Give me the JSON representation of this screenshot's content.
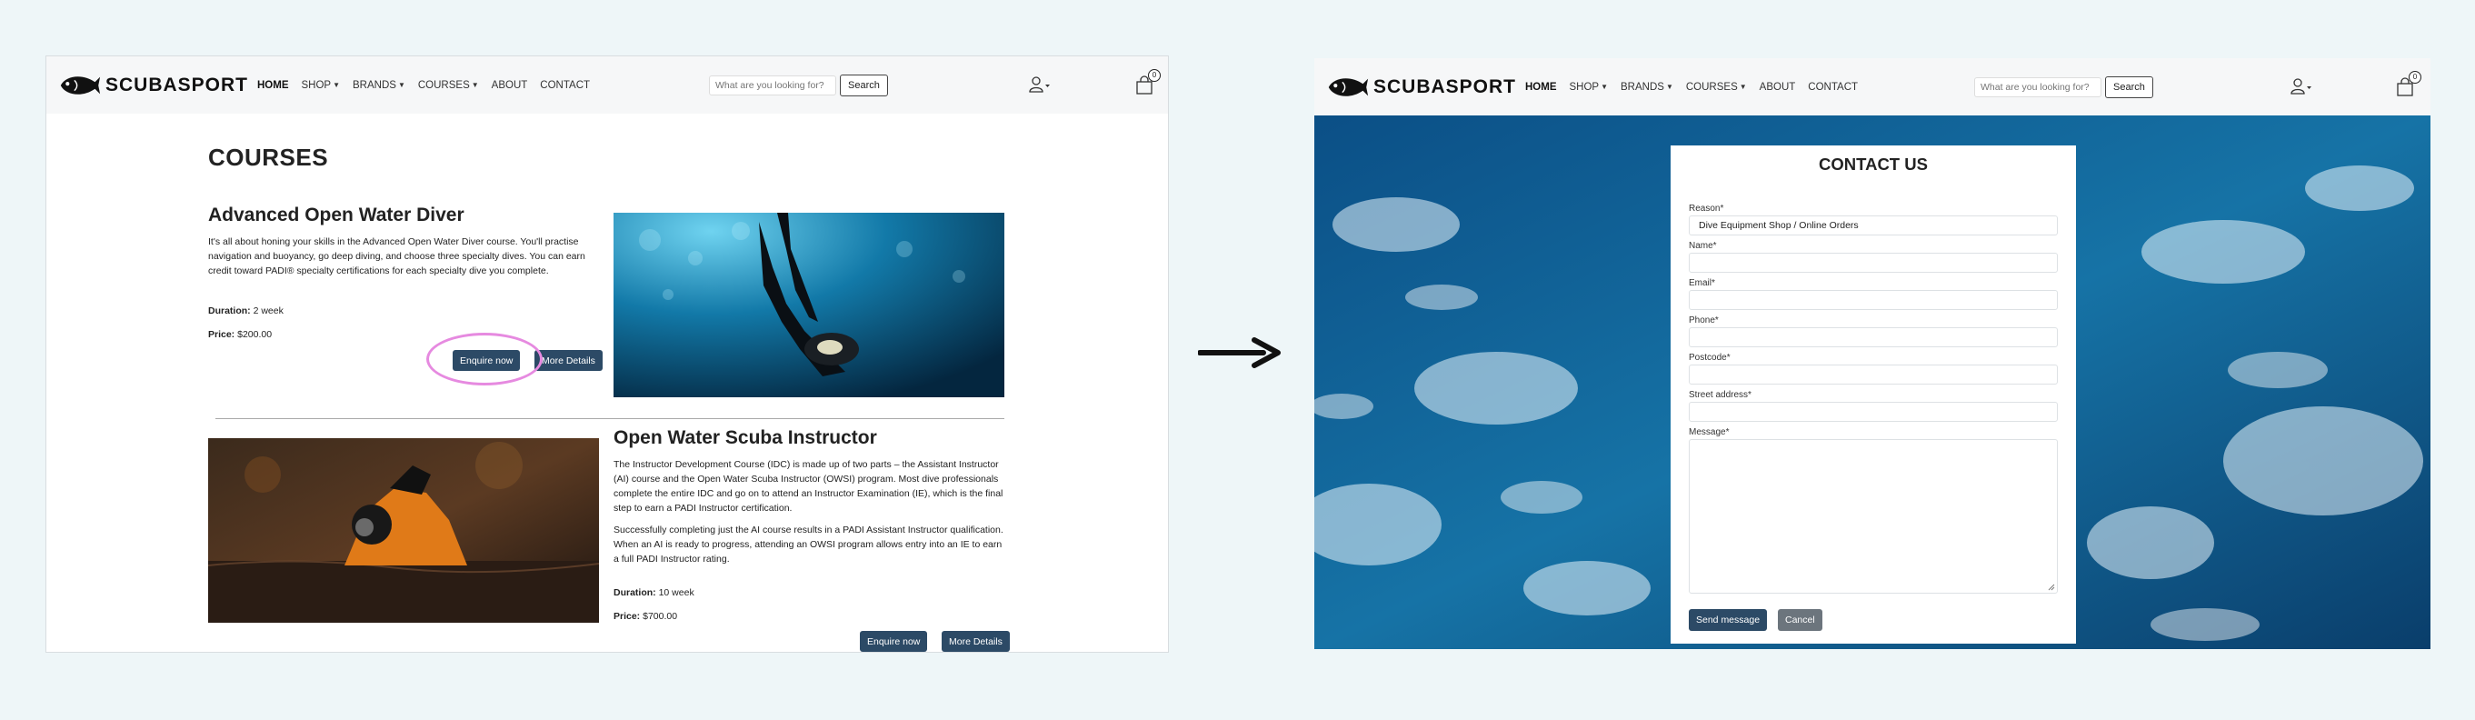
{
  "brand": {
    "name": "SCUBASPORT"
  },
  "nav": {
    "items": [
      {
        "label": "HOME",
        "active": true,
        "dropdown": false
      },
      {
        "label": "SHOP",
        "active": false,
        "dropdown": true
      },
      {
        "label": "BRANDS",
        "active": false,
        "dropdown": true
      },
      {
        "label": "COURSES",
        "active": false,
        "dropdown": true
      },
      {
        "label": "ABOUT",
        "active": false,
        "dropdown": false
      },
      {
        "label": "CONTACT",
        "active": false,
        "dropdown": false
      }
    ],
    "search_placeholder": "What are you looking for?",
    "search_button": "Search",
    "cart_count": "0",
    "icons": {
      "user": "user-icon",
      "cart": "shopping-bag-icon"
    }
  },
  "courses_page": {
    "heading": "COURSES",
    "course1": {
      "title": "Advanced Open Water Diver",
      "description": "It's all about honing your skills in the Advanced Open Water Diver course. You'll practise navigation and buoyancy, go deep diving, and choose three specialty dives. You can earn credit toward PADI® specialty certifications for each specialty dive you complete.",
      "duration_label": "Duration:",
      "duration_value": " 2 week",
      "price_label": "Price:",
      "price_value": " $200.00",
      "enquire_label": "Enquire now",
      "details_label": "More Details"
    },
    "course2": {
      "title": "Open Water Scuba Instructor",
      "description_1": "The Instructor Development Course (IDC) is made up of two parts – the Assistant Instructor (AI) course and the Open Water Scuba Instructor (OWSI) program. Most dive professionals complete the entire IDC and go on to attend an Instructor Examination (IE), which is the final step to earn a PADI Instructor certification.",
      "description_2": "Successfully completing just the AI course results in a PADI Assistant Instructor qualification. When an AI is ready to progress, attending an OWSI program allows entry into an IE to earn a full PADI Instructor rating.",
      "duration_label": "Duration:",
      "duration_value": " 10 week",
      "price_label": "Price:",
      "price_value": " $700.00",
      "enquire_label": "Enquire now",
      "details_label": "More Details"
    }
  },
  "contact_form": {
    "title": "CONTACT US",
    "reason_label": "Reason*",
    "reason_value": "Dive Equipment Shop / Online Orders",
    "name_label": "Name*",
    "email_label": "Email*",
    "phone_label": "Phone*",
    "postcode_label": "Postcode*",
    "street_label": "Street address*",
    "message_label": "Message*",
    "send_label": "Send message",
    "cancel_label": "Cancel"
  },
  "colors": {
    "primary_button": "#2c4a66",
    "cancel_button": "#6c757d",
    "highlight_ring": "#e68ae0",
    "page_background": "#eef6f8"
  }
}
